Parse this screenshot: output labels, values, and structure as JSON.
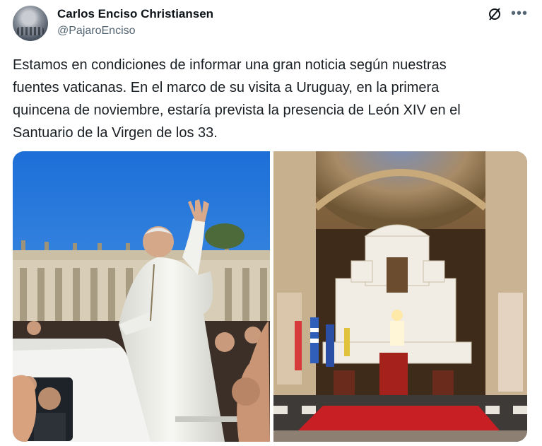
{
  "author": {
    "display_name": "Carlos Enciso Christiansen",
    "handle": "@PajaroEnciso"
  },
  "tweet": {
    "text_lines": [
      "Estamos en condiciones de informar una gran noticia según nuestras",
      "fuentes vaticanas. En el marco de su visita a Uruguay, en la primera",
      "quincena de noviembre, estaría prevista la presencia de León XIV en el",
      "Santuario de la Virgen de los 33."
    ]
  },
  "icons": {
    "grok": "grok-icon",
    "more": "more-options-icon"
  },
  "media": {
    "images": [
      {
        "subject": "photo-pope-waving"
      },
      {
        "subject": "photo-sanctuary-altar"
      }
    ]
  },
  "colors": {
    "text": "#0f1419",
    "secondary": "#536471"
  }
}
